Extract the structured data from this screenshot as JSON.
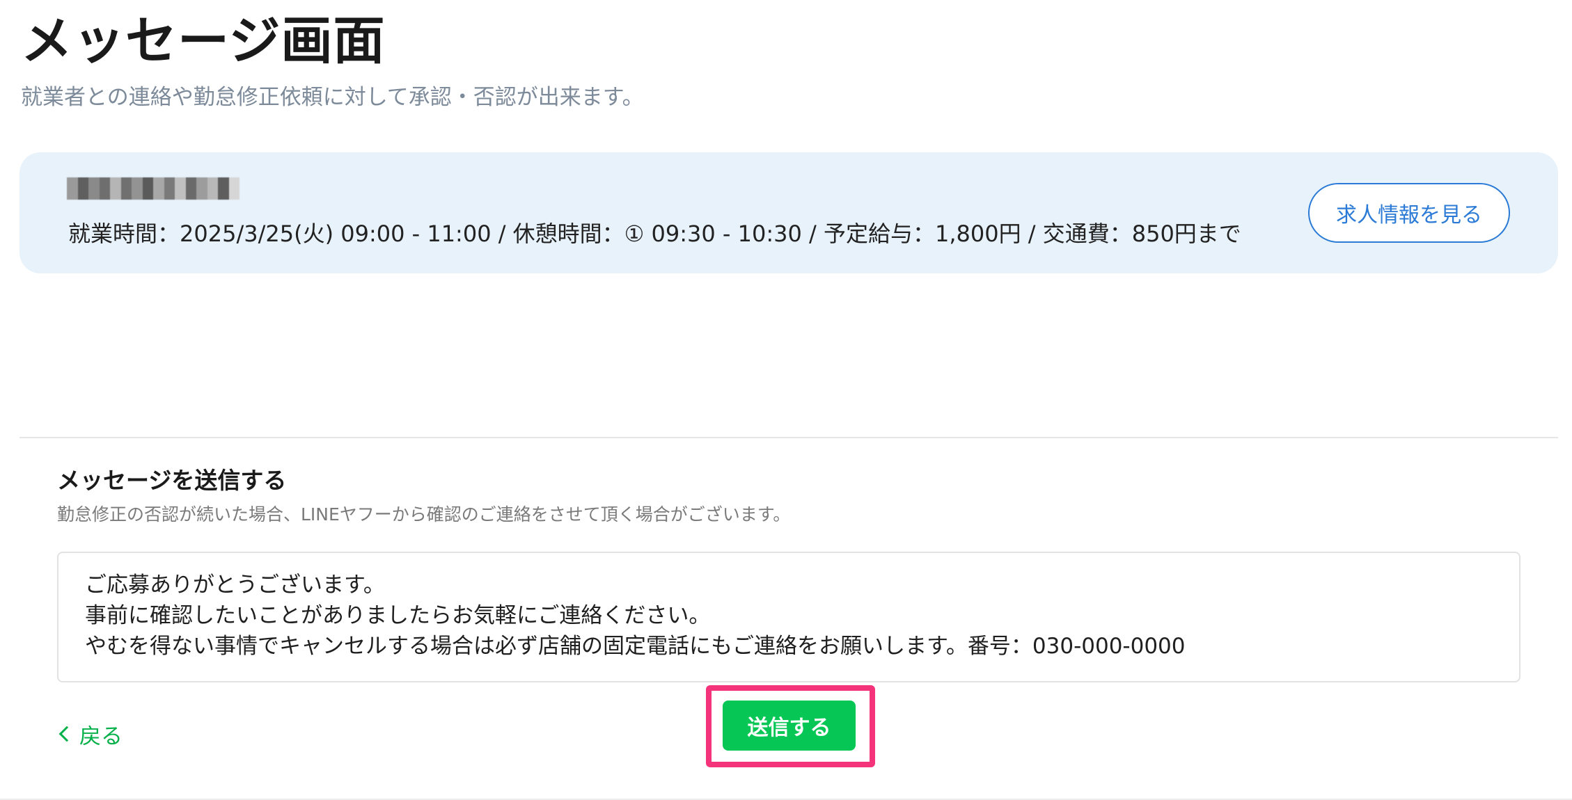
{
  "header": {
    "title": "メッセージ画面",
    "subtitle": "就業者との連絡や勤怠修正依頼に対して承認・否認が出来ます。"
  },
  "job_card": {
    "name_redacted": true,
    "details": "就業時間：2025/3/25(火) 09:00 - 11:00 / 休憩時間：① 09:30 - 10:30 / 予定給与：1,800円 / 交通費：850円まで",
    "view_job_button_label": "求人情報を見る"
  },
  "message_form": {
    "title": "メッセージを送信する",
    "note": "勤怠修正の否認が続いた場合、LINEヤフーから確認のご連絡をさせて頂く場合がございます。",
    "message_value": "ご応募ありがとうございます。\n事前に確認したいことがありましたらお気軽にご連絡ください。\nやむを得ない事情でキャンセルする場合は必ず店舗の固定電話にもご連絡をお願いします。番号：030-000-0000"
  },
  "actions": {
    "back_label": "戻る",
    "send_label": "送信する"
  },
  "colors": {
    "accent_green": "#06c755",
    "link_blue": "#2b7bd6",
    "highlight_pink": "#f5337a",
    "card_background": "#e8f2fb"
  }
}
